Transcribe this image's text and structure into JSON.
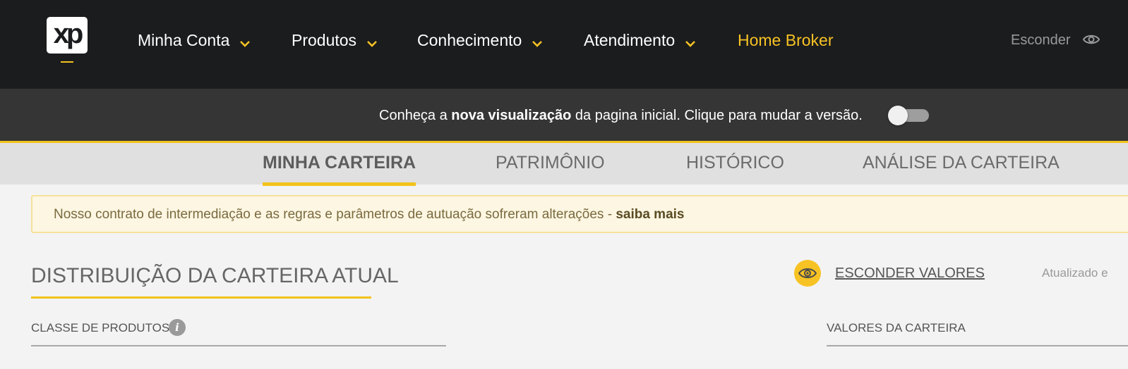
{
  "header": {
    "logo_text": "xp",
    "nav": [
      {
        "label": "Minha Conta"
      },
      {
        "label": "Produtos"
      },
      {
        "label": "Conhecimento"
      },
      {
        "label": "Atendimento"
      },
      {
        "label": "Home Broker"
      }
    ],
    "hide_label": "Esconder",
    "colors": {
      "accent": "#f7c223",
      "background": "#1b1c1e"
    }
  },
  "version_banner": {
    "prefix": "Conheça a ",
    "bold": "nova visualização",
    "suffix": " da pagina inicial. Clique para mudar a versão.",
    "toggle_on": false
  },
  "tabs": [
    {
      "label": "MINHA CARTEIRA",
      "active": true
    },
    {
      "label": "PATRIMÔNIO",
      "active": false
    },
    {
      "label": "HISTÓRICO",
      "active": false
    },
    {
      "label": "ANÁLISE DA CARTEIRA",
      "active": false
    }
  ],
  "notice": {
    "text": "Nosso contrato de intermediação e as regras e parâmetros de autuação sofreram alterações - ",
    "link": "saiba mais"
  },
  "portfolio": {
    "title": "DISTRIBUIÇÃO DA CARTEIRA ATUAL",
    "hide_values_label": "ESCONDER VALORES",
    "updated_label": "Atualizado e",
    "class_header": "CLASSE DE PRODUTOS",
    "values_header": "VALORES DA CARTEIRA"
  }
}
